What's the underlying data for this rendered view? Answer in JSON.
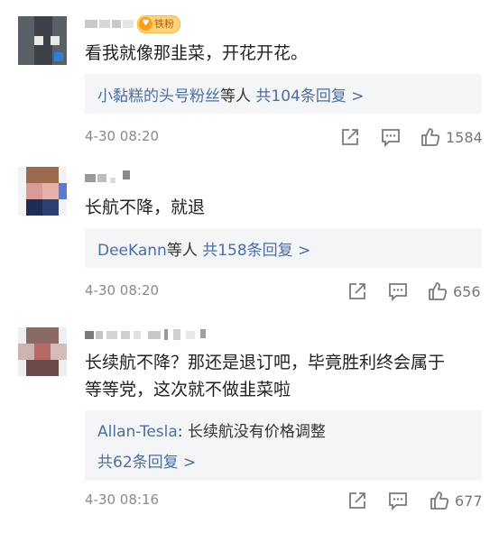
{
  "comments": [
    {
      "badge": "铁粉",
      "content_lines": [
        "看我就像那韭菜，开花开花。"
      ],
      "reply_lines": [
        {
          "name": "小黏糕的头号粉丝",
          "rest": "等人",
          "count": "共104条回复 >"
        }
      ],
      "time": "4-30 08:20",
      "likes": "1584"
    },
    {
      "content_lines": [
        "长航不降，就退"
      ],
      "reply_lines": [
        {
          "name": "DeeKann",
          "rest": "等人",
          "count": "共158条回复 >"
        }
      ],
      "time": "4-30 08:20",
      "likes": "656"
    },
    {
      "content_lines": [
        "长续航不降？那还是退订吧，毕竟胜利终会属于",
        "等等党，这次就不做韭菜啦"
      ],
      "reply_preview": {
        "name": "Allan-Tesla",
        "text": ": 长续航没有价格调整"
      },
      "reply_count": "共62条回复 >",
      "time": "4-30 08:16",
      "likes": "677"
    }
  ],
  "icons": {
    "share": "share-icon",
    "comment": "comment-icon",
    "like": "thumbs-up-icon"
  },
  "colors": {
    "link_blue": "#4b6ea3",
    "reply_bg": "#f4f5f7",
    "time_gray": "#8a8a8a"
  }
}
